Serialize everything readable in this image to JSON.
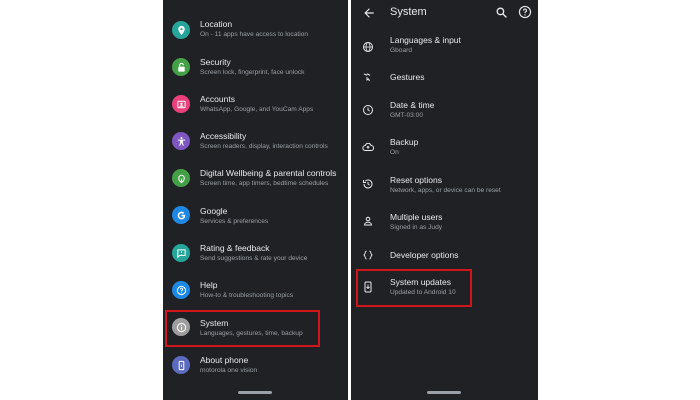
{
  "left_screen": {
    "items": [
      {
        "title": "Location",
        "subtitle": "On - 11 apps have access to location",
        "icon": "location-pin-icon",
        "color": "#26a69a"
      },
      {
        "title": "Security",
        "subtitle": "Screen lock, fingerprint, face unlock",
        "icon": "lock-icon",
        "color": "#43a047"
      },
      {
        "title": "Accounts",
        "subtitle": "WhatsApp, Google, and YouCam Apps",
        "icon": "account-icon",
        "color": "#ec407a"
      },
      {
        "title": "Accessibility",
        "subtitle": "Screen readers, display, interaction controls",
        "icon": "accessibility-icon",
        "color": "#7e57c2"
      },
      {
        "title": "Digital Wellbeing & parental controls",
        "subtitle": "Screen time, app timers, bedtime schedules",
        "icon": "wellbeing-icon",
        "color": "#43a047"
      },
      {
        "title": "Google",
        "subtitle": "Services & preferences",
        "icon": "google-icon",
        "color": "#1e88e5"
      },
      {
        "title": "Rating & feedback",
        "subtitle": "Send suggestions & rate your device",
        "icon": "feedback-icon",
        "color": "#26a69a"
      },
      {
        "title": "Help",
        "subtitle": "How-to & troubleshooting topics",
        "icon": "help-icon",
        "color": "#1e88e5"
      },
      {
        "title": "System",
        "subtitle": "Languages, gestures, time, backup",
        "icon": "info-icon",
        "color": "#9e9e9e"
      },
      {
        "title": "About phone",
        "subtitle": "motorola one vision",
        "icon": "phone-icon",
        "color": "#5c6bc0"
      }
    ]
  },
  "right_screen": {
    "title": "System",
    "items": [
      {
        "title": "Languages & input",
        "subtitle": "Gboard",
        "icon": "globe-icon"
      },
      {
        "title": "Gestures",
        "subtitle": "",
        "icon": "gesture-icon"
      },
      {
        "title": "Date & time",
        "subtitle": "GMT-03:00",
        "icon": "clock-icon"
      },
      {
        "title": "Backup",
        "subtitle": "On",
        "icon": "cloud-backup-icon"
      },
      {
        "title": "Reset options",
        "subtitle": "Network, apps, or device can be reset",
        "icon": "history-icon"
      },
      {
        "title": "Multiple users",
        "subtitle": "Signed in as Judy",
        "icon": "person-icon"
      },
      {
        "title": "Developer options",
        "subtitle": "",
        "icon": "code-braces-icon"
      },
      {
        "title": "System updates",
        "subtitle": "Updated to Android 10",
        "icon": "system-update-icon"
      }
    ]
  },
  "colors": {
    "highlight": "#d0161b",
    "background": "#202124",
    "text": "#e8eaed",
    "subtext": "#9aa0a6"
  }
}
